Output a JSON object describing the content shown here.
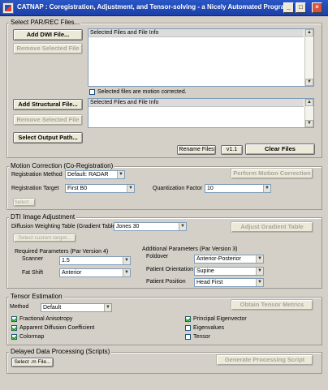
{
  "window": {
    "title": "CATNAP : Coregistration, Adjustment, and Tensor-solving  - a Nicely Automated Program",
    "min_label": "_",
    "max_label": "□",
    "close_label": "×"
  },
  "par_rec": {
    "title": "Select PAR/REC Files...",
    "add_dwi_label": "Add DWI File...",
    "remove_dwi_label": "Remove Selected File",
    "dwi_list_header": "Selected Files and File Info",
    "motion_corrected_label": "Selected files are motion corrected.",
    "motion_corrected_checked": false,
    "add_structural_label": "Add Structural File...",
    "remove_structural_label": "Remove Selected File",
    "structural_list_header": "Selected Files and File Info",
    "select_output_label": "Select Output Path...",
    "rename_label": "Rename Files",
    "version_label": "v1.1",
    "clear_label": "Clear Files"
  },
  "motion": {
    "title": "Motion Correction (Co-Registration)",
    "method_label": "Registration Method",
    "method_value": "Default: RADAR",
    "target_label": "Registration Target",
    "target_value": "First B0",
    "quant_label": "Quantization Factor",
    "quant_value": "10",
    "select_label": "Select ...",
    "perform_label": "Perform Motion Correction"
  },
  "dti": {
    "title": "DTI Image Adjustment",
    "gradient_table_label": "Diffusion Weighting Table (Gradient Table)",
    "gradient_table_value": "Jones 30",
    "adjust_label": "Adjust Gradient Table",
    "custom_target_label": "Select custom target...",
    "required_label": "Required Parameters (Par Version 4)",
    "scanner_label": "Scanner",
    "scanner_value": "1.5",
    "fatshift_label": "Fat Shift",
    "fatshift_value": "Anterior",
    "additional_label": "Additional Parameters (Par Version 3)",
    "foldover_label": "Foldover",
    "foldover_value": "Anterior-Posterior",
    "orientation_label": "Patient Orientation",
    "orientation_value": "Supine",
    "position_label": "Patient Position",
    "position_value": "Head First"
  },
  "tensor": {
    "title": "Tensor Estimation",
    "method_label": "Method",
    "method_value": "Default",
    "obtain_label": "Obtain Tensor Metrics",
    "options": [
      {
        "label": "Fractional Anisotropy",
        "checked": true
      },
      {
        "label": "Apparent Diffusion Coefficient",
        "checked": true
      },
      {
        "label": "Colormap",
        "checked": true
      },
      {
        "label": "Principal Eigenvector",
        "checked": true
      },
      {
        "label": "Eigenvalues",
        "checked": false
      },
      {
        "label": "Tensor",
        "checked": false
      }
    ]
  },
  "delayed": {
    "title": "Delayed Data Processing (Scripts)",
    "select_m_label": "Select .m File...",
    "generate_label": "Generate Processing Script"
  },
  "icons": {
    "scroll_up": "▲",
    "scroll_down": "▼",
    "dropdown": "▼"
  }
}
